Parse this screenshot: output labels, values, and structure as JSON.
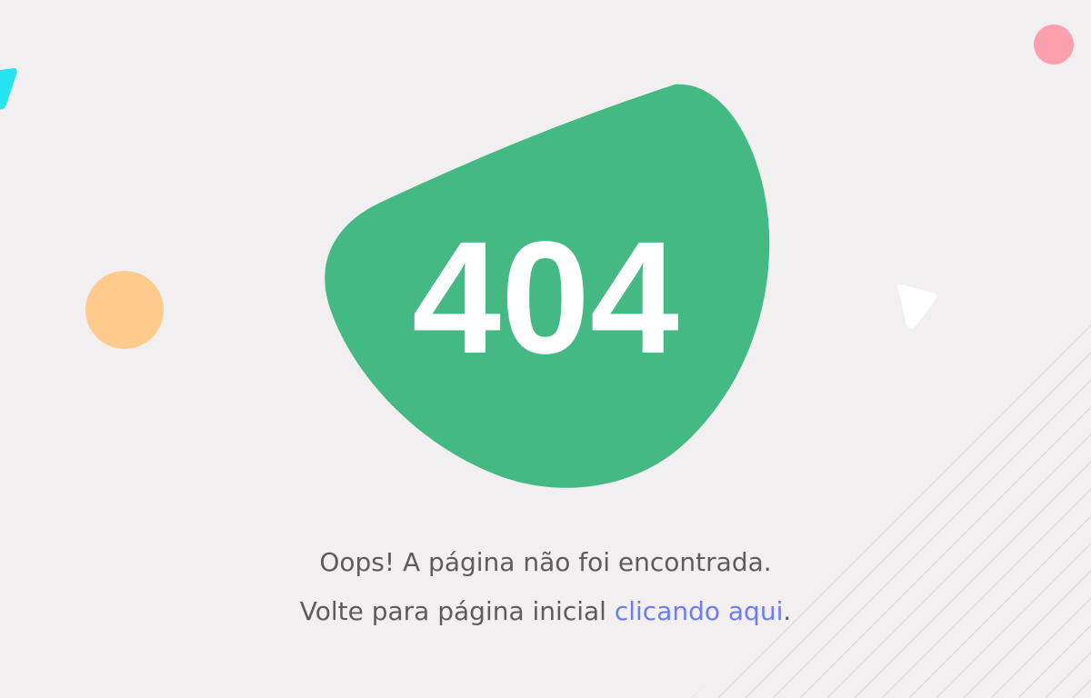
{
  "error": {
    "code": "404"
  },
  "message": {
    "line1": "Oops! A página não foi encontrada.",
    "line2_prefix": "Volte para página inicial ",
    "link_label": "clicando aqui",
    "line2_suffix": "."
  },
  "colors": {
    "background": "#f1eff0",
    "blob": "#44b984",
    "link": "#6d7cf0",
    "text": "#5e5b5d",
    "orange_circle": "#fecb8c",
    "pink_circle": "#fe9fae",
    "cyan_shape": "#25e4ef",
    "stripes": "#dcdadb"
  },
  "icons": {
    "orange_circle": "circle-shape-icon",
    "pink_circle": "circle-shape-icon",
    "cyan_shape": "triangle-shape-icon",
    "white_triangle": "triangle-shape-icon"
  }
}
